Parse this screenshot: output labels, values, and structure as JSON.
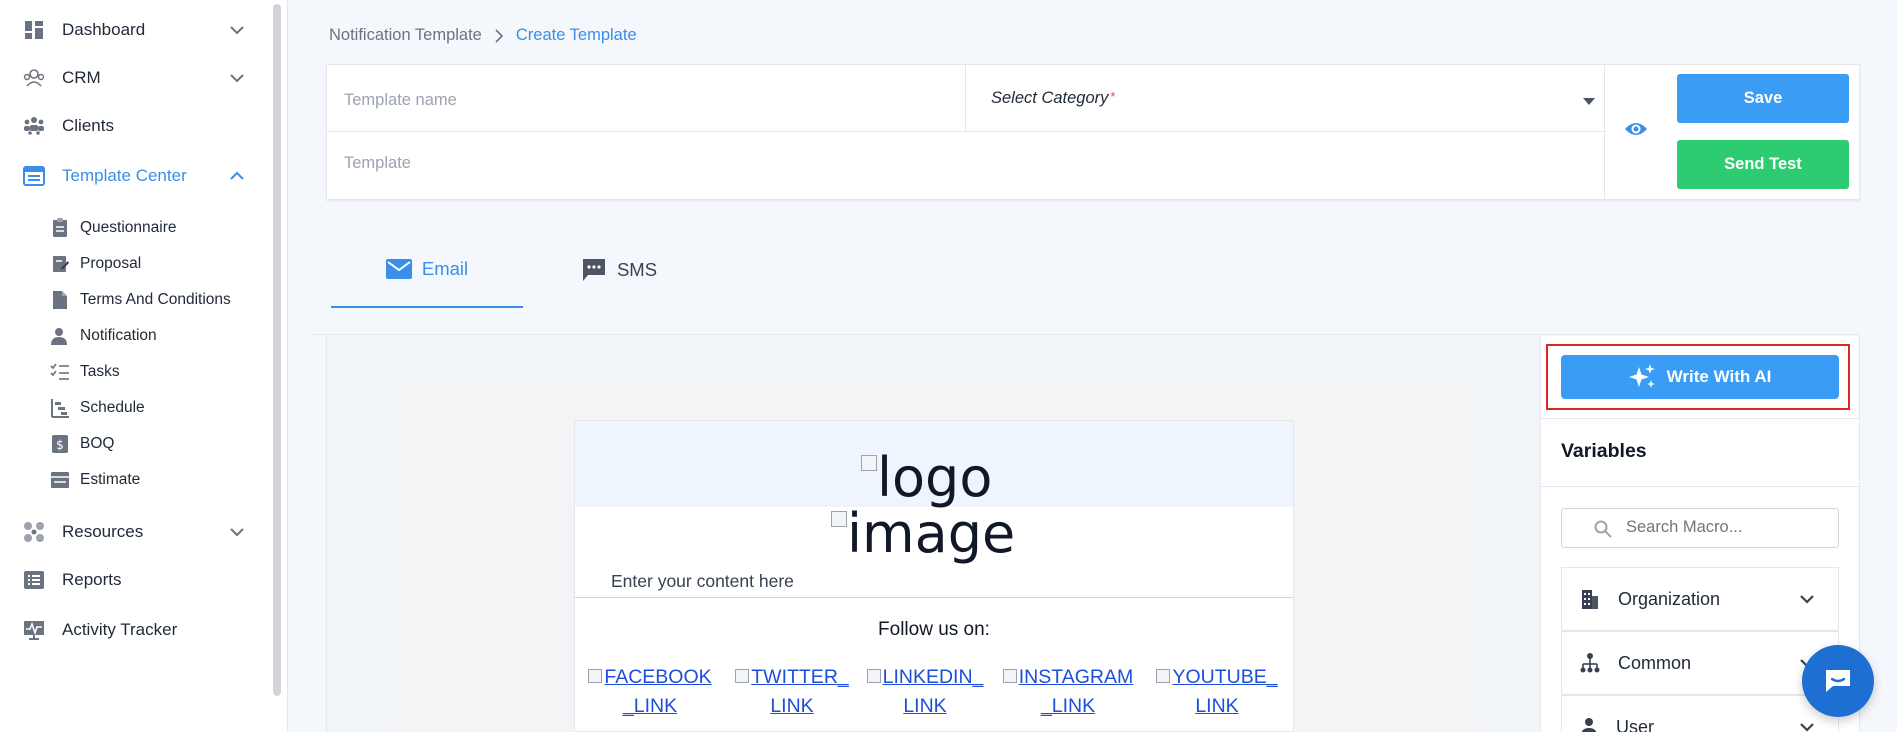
{
  "sidebar": {
    "items": [
      {
        "label": "Dashboard",
        "icon": "dashboard-icon"
      },
      {
        "label": "CRM",
        "icon": "crm-icon"
      },
      {
        "label": "Clients",
        "icon": "clients-icon"
      },
      {
        "label": "Template Center",
        "icon": "template-icon"
      },
      {
        "label": "Resources",
        "icon": "resources-icon"
      },
      {
        "label": "Reports",
        "icon": "reports-icon"
      },
      {
        "label": "Activity Tracker",
        "icon": "activity-icon"
      }
    ],
    "sub_items": [
      {
        "label": "Questionnaire"
      },
      {
        "label": "Proposal"
      },
      {
        "label": "Terms And Conditions"
      },
      {
        "label": "Notification"
      },
      {
        "label": "Tasks"
      },
      {
        "label": "Schedule"
      },
      {
        "label": "BOQ"
      },
      {
        "label": "Estimate"
      }
    ]
  },
  "breadcrumb": {
    "parent": "Notification Template",
    "current": "Create Template"
  },
  "form": {
    "template_name_placeholder": "Template name",
    "category_label": "Select Category",
    "required_mark": "*",
    "template_placeholder": "Template",
    "save_label": "Save",
    "send_test_label": "Send Test"
  },
  "tabs": [
    {
      "label": "Email",
      "active": true
    },
    {
      "label": "SMS",
      "active": false
    }
  ],
  "email": {
    "logo_alt": "logo",
    "image_alt": "image",
    "content_placeholder": "Enter your content here",
    "follow_text": "Follow us on:",
    "social": [
      {
        "l1": "FACEBOOK",
        "l2": "_LINK"
      },
      {
        "l1": "TWITTER_",
        "l2": "LINK"
      },
      {
        "l1": "LINKEDIN_",
        "l2": "LINK"
      },
      {
        "l1": "INSTAGRAM",
        "l2": "_LINK"
      },
      {
        "l1": "YOUTUBE_",
        "l2": "LINK"
      }
    ]
  },
  "panel": {
    "ai_label": "Write With AI",
    "variables_title": "Variables",
    "search_placeholder": "Search Macro...",
    "groups": [
      {
        "label": "Organization"
      },
      {
        "label": "Common"
      },
      {
        "label": "User"
      }
    ]
  },
  "colors": {
    "accent": "#3b8ee8",
    "primary_button": "#3b9cf5",
    "success_button": "#2ecc71",
    "highlight": "#dc2626"
  }
}
